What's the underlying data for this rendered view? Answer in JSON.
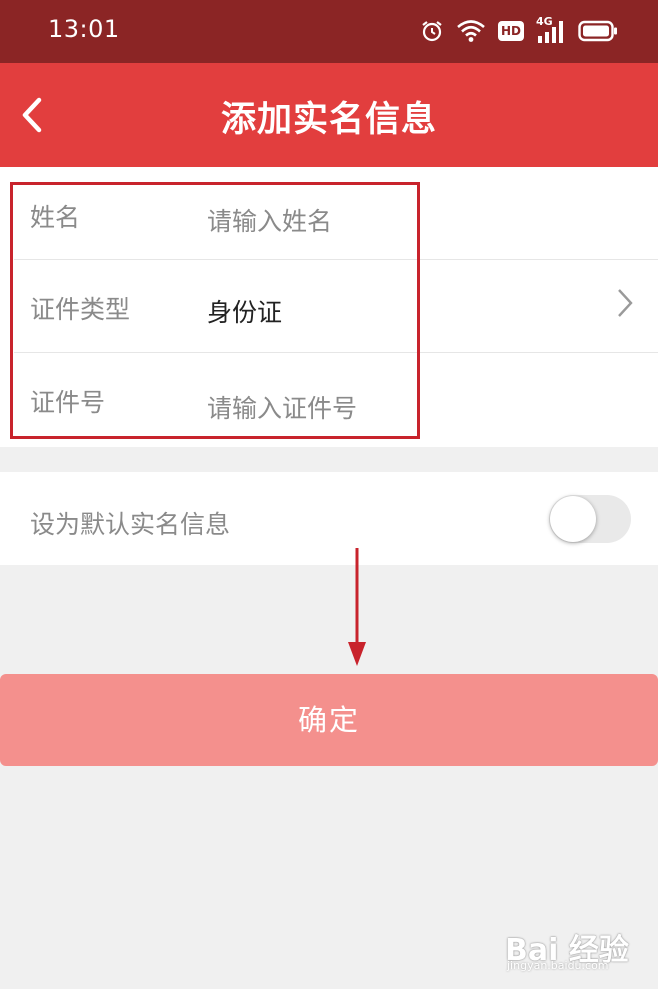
{
  "status_bar": {
    "time": "13:01",
    "icons": [
      "alarm-icon",
      "wifi-icon",
      "hd-icon",
      "signal-4g-icon",
      "battery-icon"
    ],
    "hd_label": "HD",
    "network_label": "4G"
  },
  "nav": {
    "title": "添加实名信息",
    "back_icon": "chevron-left-icon"
  },
  "form": {
    "name_label": "姓名",
    "name_placeholder": "请输入姓名",
    "id_type_label": "证件类型",
    "id_type_value": "身份证",
    "id_number_label": "证件号",
    "id_number_placeholder": "请输入证件号"
  },
  "default_setting": {
    "label": "设为默认实名信息",
    "enabled": false
  },
  "confirm_button": {
    "label": "确定"
  },
  "watermark": {
    "brand": "Bai 经验",
    "sub": "jingyan.baidu.com"
  },
  "colors": {
    "status_bar": "#8b2525",
    "nav_bar": "#e23e3e",
    "confirm_button": "#f4908d",
    "annotation": "#c8232c"
  }
}
